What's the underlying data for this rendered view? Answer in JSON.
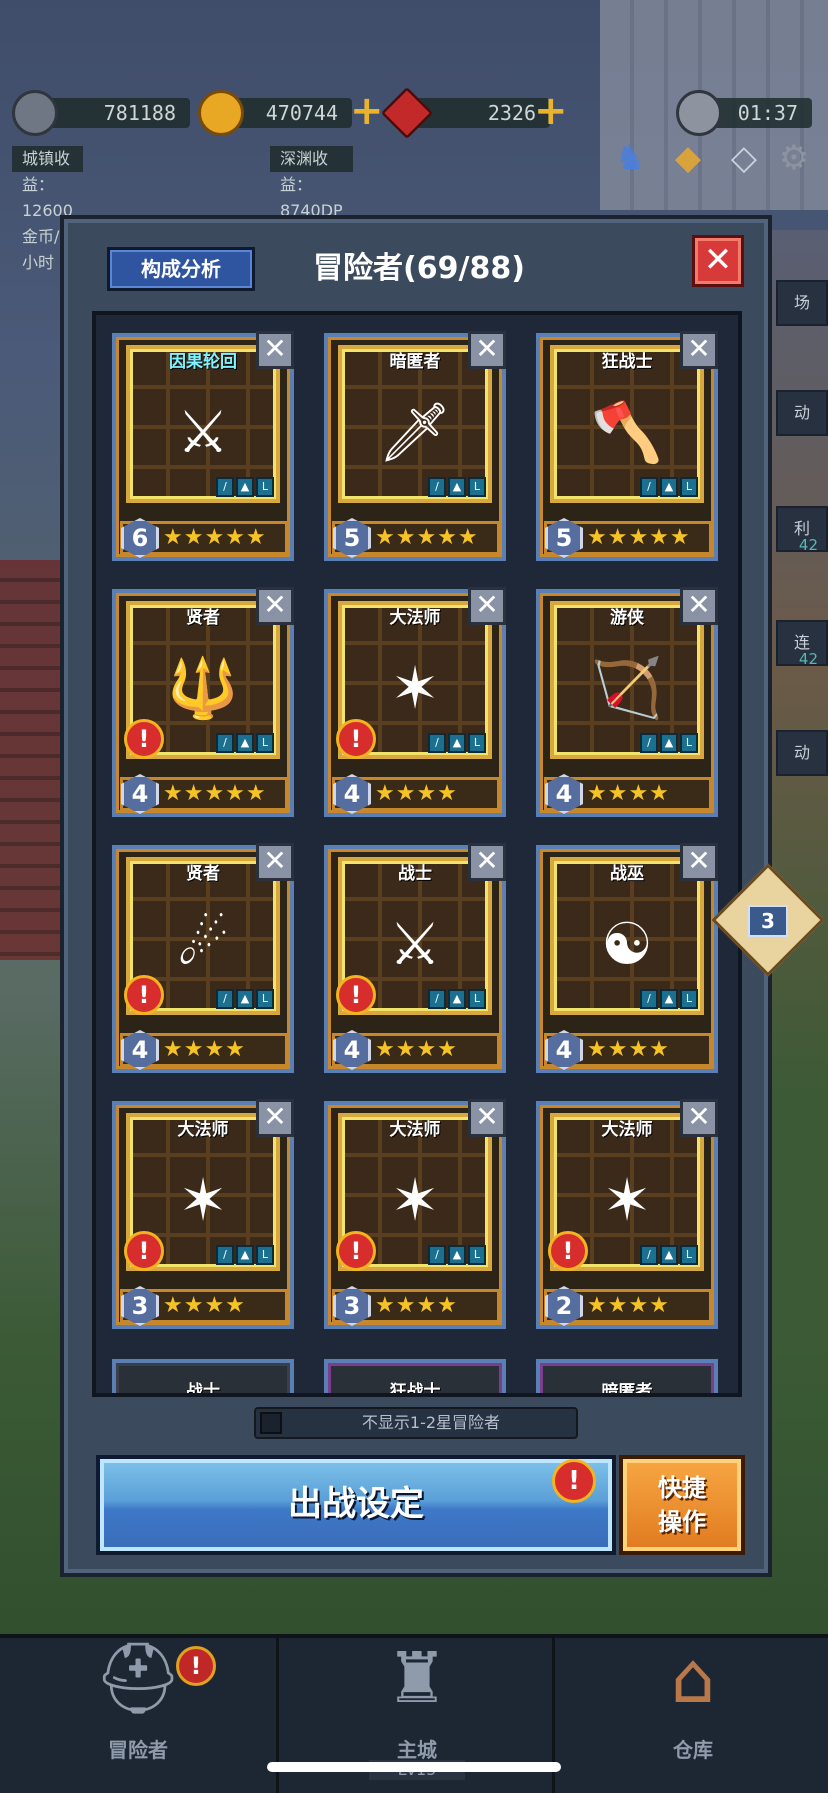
{
  "hud": {
    "pickaxe_value": "781188",
    "gold_value": "470744",
    "gem_value": "2326",
    "timer": "01:37",
    "town_income": "城镇收益：12600金币/小时",
    "abyss_income": "深渊收益：8740DP"
  },
  "modal": {
    "analysis_label": "构成分析",
    "title": "冒险者(69/88)",
    "close_label": "✕"
  },
  "cards": [
    {
      "name": "因果轮回",
      "level": "6",
      "stars": "★★★★★",
      "alert": false,
      "highlight": true
    },
    {
      "name": "暗匿者",
      "level": "5",
      "stars": "★★★★★",
      "alert": false,
      "highlight": false
    },
    {
      "name": "狂战士",
      "level": "5",
      "stars": "★★★★★",
      "alert": false,
      "highlight": false
    },
    {
      "name": "贤者",
      "level": "4",
      "stars": "★★★★★",
      "alert": true,
      "highlight": false
    },
    {
      "name": "大法师",
      "level": "4",
      "stars": "★★★★",
      "alert": true,
      "highlight": false
    },
    {
      "name": "游侠",
      "level": "4",
      "stars": "★★★★",
      "alert": false,
      "highlight": false
    },
    {
      "name": "贤者",
      "level": "4",
      "stars": "★★★★",
      "alert": true,
      "highlight": false
    },
    {
      "name": "战士",
      "level": "4",
      "stars": "★★★★",
      "alert": true,
      "highlight": false
    },
    {
      "name": "战巫",
      "level": "4",
      "stars": "★★★★",
      "alert": false,
      "highlight": false
    },
    {
      "name": "大法师",
      "level": "3",
      "stars": "★★★★",
      "alert": true,
      "highlight": false
    },
    {
      "name": "大法师",
      "level": "3",
      "stars": "★★★★",
      "alert": true,
      "highlight": false
    },
    {
      "name": "大法师",
      "level": "2",
      "stars": "★★★★",
      "alert": true,
      "highlight": false
    }
  ],
  "partial_cards": [
    "战士",
    "狂战士",
    "暗匿者"
  ],
  "side_badge": "3",
  "toggle_label": "不显示1-2星冒险者",
  "battle_button": "出战设定",
  "quick_button": [
    "快捷",
    "操作"
  ],
  "alert_symbol": "!",
  "nav": {
    "adventurers": "冒险者",
    "main_city": "主城",
    "main_city_level": "Lv15",
    "warehouse": "仓库"
  },
  "side_tags": [
    "场",
    "动",
    "利",
    "连",
    "动"
  ],
  "side_nums": [
    "42",
    "42"
  ]
}
